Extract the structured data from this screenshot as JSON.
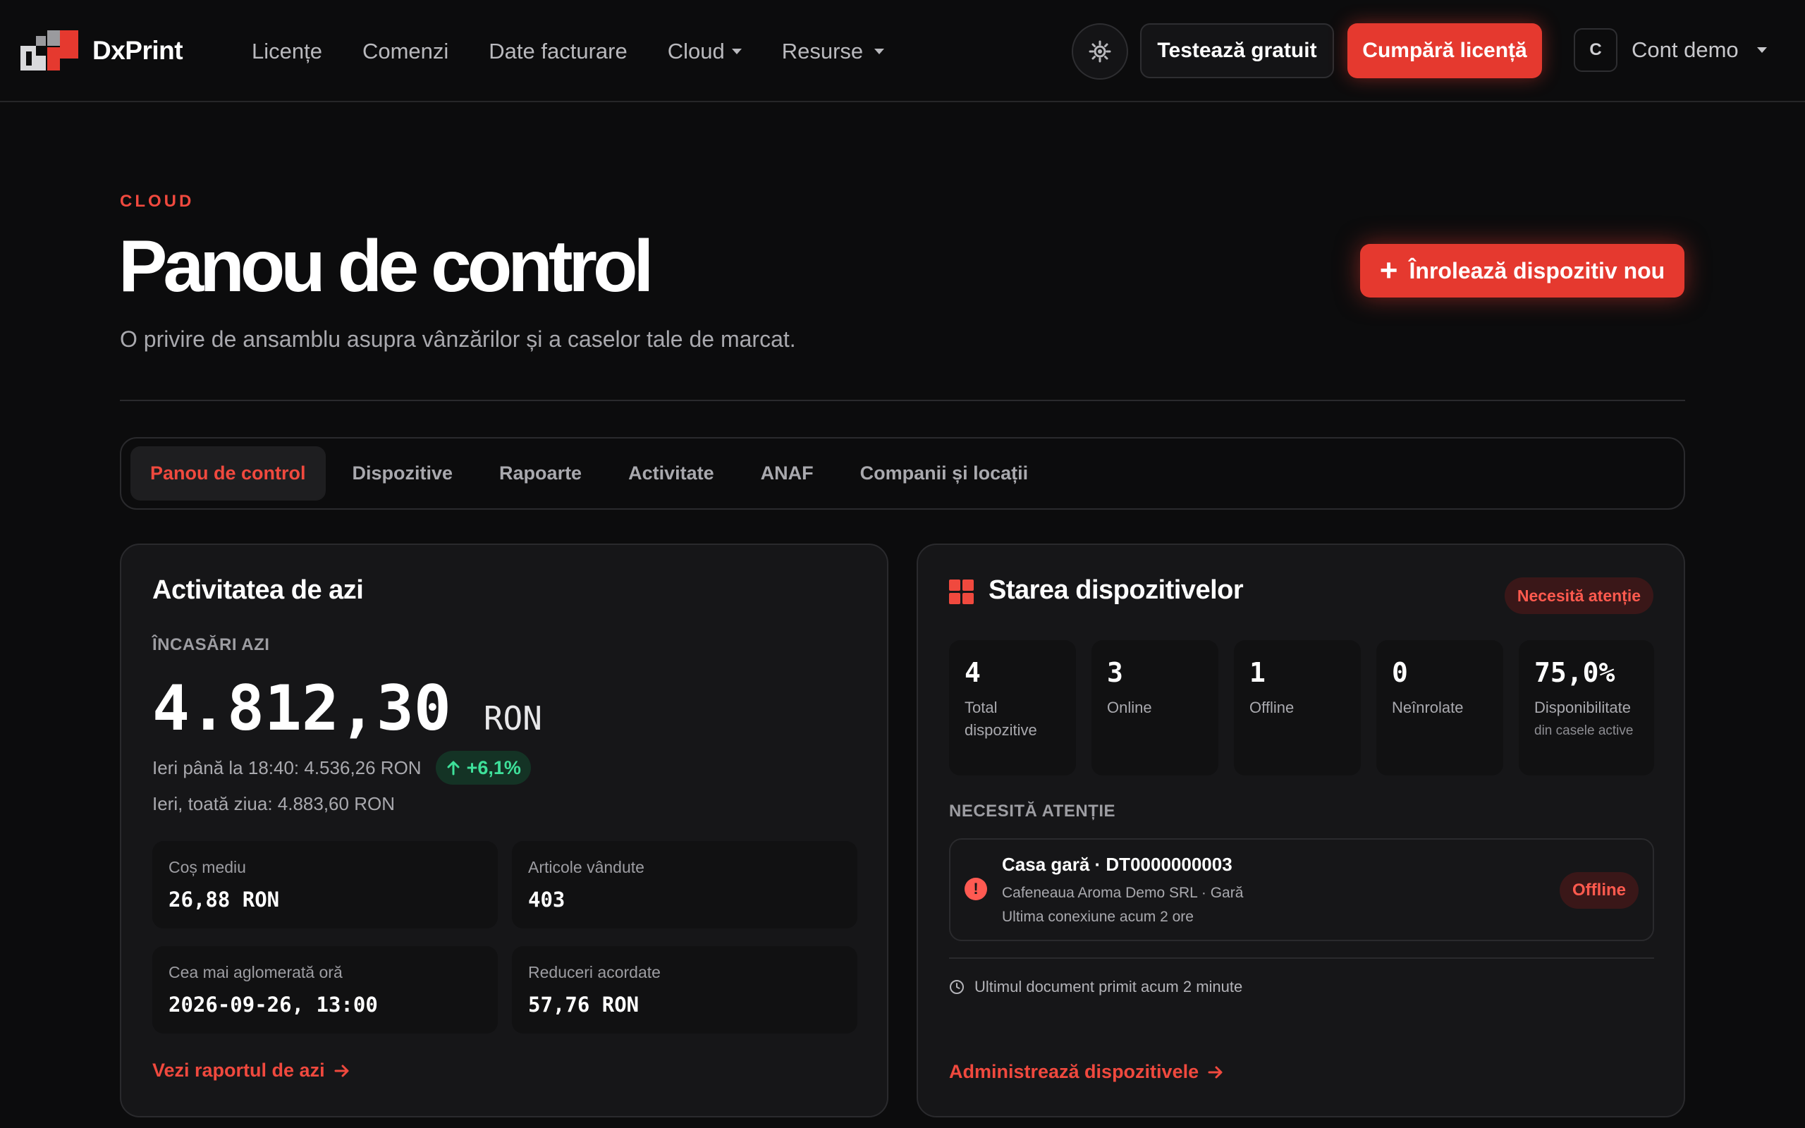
{
  "nav": {
    "brand": "DxPrint",
    "links": [
      {
        "label": "Licențe",
        "has_caret": false
      },
      {
        "label": "Comenzi",
        "has_caret": false
      },
      {
        "label": "Date facturare",
        "has_caret": false
      },
      {
        "label": "Cloud",
        "has_caret": true
      },
      {
        "label": "Resurse",
        "has_caret": true
      }
    ],
    "theme_icon": "sun-gear-icon",
    "try_label": "Testează gratuit",
    "buy_label": "Cumpără licență",
    "account_initial": "C",
    "account_name": "Cont demo"
  },
  "header": {
    "eyebrow": "CLOUD",
    "title": "Panou de control",
    "subtitle": "O privire de ansamblu asupra vânzărilor și a caselor tale de marcat.",
    "enroll_label": "Înrolează dispozitiv nou"
  },
  "tabs": [
    {
      "label": "Panou de control",
      "active": true
    },
    {
      "label": "Dispozitive",
      "active": false
    },
    {
      "label": "Rapoarte",
      "active": false
    },
    {
      "label": "Activitate",
      "active": false
    },
    {
      "label": "ANAF",
      "active": false
    },
    {
      "label": "Companii și locații",
      "active": false
    }
  ],
  "today": {
    "title": "Activitatea de azi",
    "income_label": "ÎNCASĂRI AZI",
    "amount": "4.812,30",
    "currency": "RON",
    "yesterday_partial": "Ieri până la 18:40: 4.536,26 RON",
    "trend": "+6,1%",
    "yesterday_full": "Ieri, toată ziua: 4.883,60 RON",
    "stats": [
      {
        "label": "Coș mediu",
        "value": "26,88 RON"
      },
      {
        "label": "Articole vândute",
        "value": "403"
      },
      {
        "label": "Cea mai aglomerată oră",
        "value": "2026-09-26, 13:00"
      },
      {
        "label": "Reduceri acordate",
        "value": "57,76 RON"
      }
    ],
    "report_link": "Vezi raportul de azi"
  },
  "devices": {
    "title": "Starea dispozitivelor",
    "status_badge": "Necesită atenție",
    "kpis": [
      {
        "value": "4",
        "label": "Total dispozitive",
        "sub": ""
      },
      {
        "value": "3",
        "label": "Online",
        "sub": ""
      },
      {
        "value": "1",
        "label": "Offline",
        "sub": ""
      },
      {
        "value": "0",
        "label": "Neînrolate",
        "sub": ""
      },
      {
        "value": "75,0%",
        "label": "Disponibilitate",
        "sub": "din casele active"
      }
    ],
    "attention_label": "NECESITĂ ATENȚIE",
    "alert": {
      "title": "Casa gară · DT0000000003",
      "subtitle": "Cafeneaua Aroma Demo SRL · Gară",
      "time": "Ultima conexiune acum 2 ore",
      "badge": "Offline"
    },
    "last_document": "Ultimul document primit acum 2 minute",
    "manage_link": "Administrează dispozitivele"
  },
  "colors": {
    "accent": "#e5392f",
    "background": "#0c0c0d",
    "card": "#161618",
    "success": "#3ee09a"
  }
}
